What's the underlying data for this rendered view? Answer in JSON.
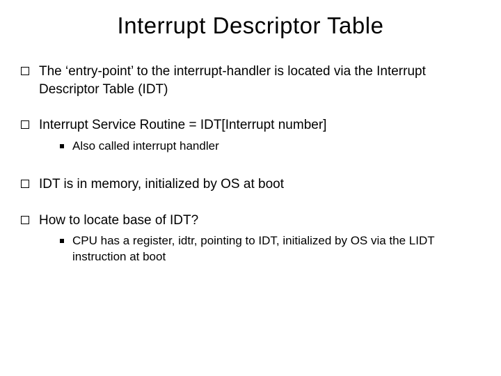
{
  "title": "Interrupt Descriptor Table",
  "items": [
    {
      "text": "The ‘entry-point’ to the interrupt-handler is located via the Interrupt Descriptor Table (IDT)",
      "subs": []
    },
    {
      "text": "Interrupt Service Routine = IDT[Interrupt number]",
      "subs": [
        {
          "text": "Also called interrupt handler"
        }
      ]
    },
    {
      "text": "IDT is in memory, initialized by OS at boot",
      "subs": []
    },
    {
      "text": "How to locate base of IDT?",
      "subs": [
        {
          "text": "CPU has a register, idtr, pointing to IDT, initialized by OS via the LIDT instruction at boot"
        }
      ]
    }
  ]
}
